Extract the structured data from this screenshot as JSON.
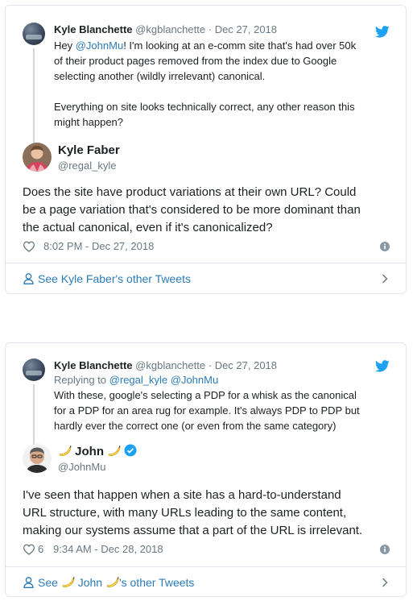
{
  "card1": {
    "parent": {
      "name": "Kyle Blanchette",
      "handle": "@kgblanchette",
      "sep": "·",
      "date": "Dec 27, 2018",
      "text_prefix": "Hey ",
      "mention": "@JohnMu",
      "text_line1_rest": "! I'm looking at an e-comm site that's had over 50k",
      "text_line2": "of their product pages removed from the index due to Google",
      "text_line3": "selecting another (wildly irrelevant) canonical.",
      "text_line4": "Everything on site looks technically correct, any other reason this",
      "text_line5": "might happen?"
    },
    "author": {
      "name": "Kyle Faber",
      "handle": "@regal_kyle"
    },
    "text_lines": [
      "Does the site have product variations at their own URL? Could",
      "be a page variation that's considered to be more dominant than",
      "the actual canonical, even if it's canonicalized?"
    ],
    "like_count": "",
    "timestamp": "8:02 PM - Dec 27, 2018",
    "see_more": "See Kyle Faber's other Tweets"
  },
  "card2": {
    "parent": {
      "name": "Kyle Blanchette",
      "handle": "@kgblanchette",
      "sep": "·",
      "date": "Dec 27, 2018",
      "reply_prefix": "Replying to",
      "reply_to_1": "@regal_kyle",
      "reply_to_2": "@JohnMu",
      "text_line1": "With these, google's selecting a PDP for a whisk as the canonical",
      "text_line2": "for a PDP for an area rug for example. It's always PDP to PDP but",
      "text_line3": "hardly ever the correct one (or even from the same category)"
    },
    "author": {
      "name": "John",
      "handle": "@JohnMu"
    },
    "text_lines": [
      "I've seen that happen when a site has a hard-to-understand",
      "URL structure, with many URLs leading to the same content,",
      "making our systems assume that a part of the URL is irrelevant."
    ],
    "like_count": "6",
    "timestamp": "9:34 AM - Dec 28, 2018",
    "see_more_prefix": "See",
    "see_more_name": "John",
    "see_more_suffix": "'s other Tweets"
  },
  "colors": {
    "link": "#2b7bb9",
    "muted": "#697882",
    "border": "#e1e8ed",
    "verified": "#1da1f2"
  },
  "icons": [
    "twitter-bird-icon",
    "heart-icon",
    "info-icon",
    "person-icon",
    "chevron-right-icon",
    "banana-emoji-icon",
    "verified-badge-icon"
  ]
}
